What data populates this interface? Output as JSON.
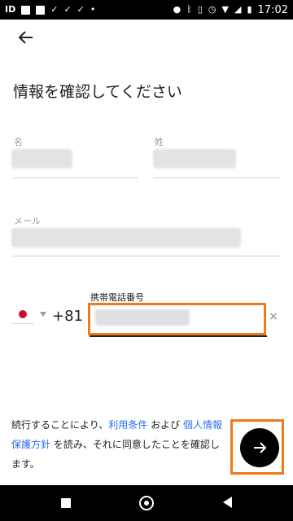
{
  "status_bar": {
    "time": "17:02",
    "left_icons": [
      "id-icon",
      "image-icon",
      "alert-icon",
      "check-icon",
      "check-icon",
      "check-icon",
      "dot-icon"
    ],
    "right_icons": [
      "location-icon",
      "bluetooth-icon",
      "vibrate-icon",
      "alarm-icon",
      "wifi-icon",
      "signal-icon",
      "battery-icon"
    ]
  },
  "header": {
    "back_icon": "arrow-left-icon",
    "title": "情報を確認してください"
  },
  "form": {
    "first_name_label": "名",
    "last_name_label": "姓",
    "email_label": "メール",
    "country_flag": "japan-flag-icon",
    "country_code": "+81",
    "phone_label": "携帯電話番号",
    "clear_icon": "×"
  },
  "legal": {
    "text_1": "続行することにより、",
    "link_terms": "利用条件",
    "text_2": " および ",
    "link_privacy": "個人情報保護方針",
    "text_3": " を読み、それに同意したことを確認します。"
  },
  "next_button": {
    "icon": "arrow-right-icon"
  },
  "colors": {
    "highlight": "#f07a1a",
    "link": "#276ef1",
    "fab": "#000000"
  }
}
